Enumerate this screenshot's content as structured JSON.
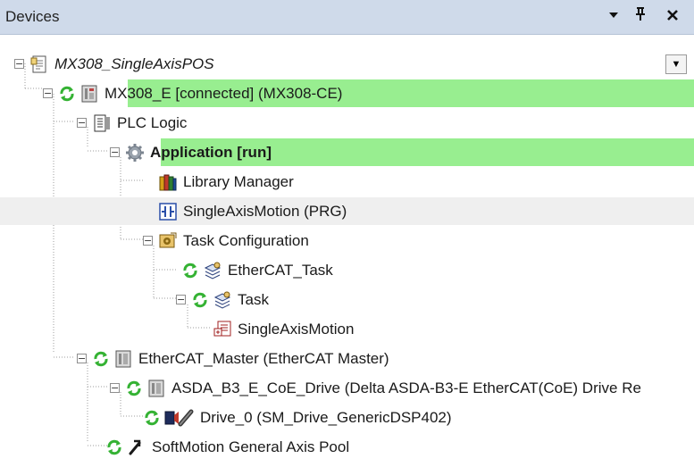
{
  "panel": {
    "title": "Devices",
    "pin_label": "‑↔",
    "close_label": "✕"
  },
  "tree": {
    "project": "MX308_SingleAxisPOS",
    "device": "MX308_E [connected] (MX308-CE)",
    "plc_logic": "PLC Logic",
    "application": "Application [run]",
    "library_manager": "Library Manager",
    "single_axis_motion_prg": "SingleAxisMotion (PRG)",
    "task_configuration": "Task Configuration",
    "ethercat_task": "EtherCAT_Task",
    "task": "Task",
    "single_axis_motion": "SingleAxisMotion",
    "ethercat_master": "EtherCAT_Master (EtherCAT Master)",
    "asda_drive": "ASDA_B3_E_CoE_Drive (Delta ASDA-B3-E EtherCAT(CoE) Drive Re",
    "drive_0": "Drive_0 (SM_Drive_GenericDSP402)",
    "axis_pool": "SoftMotion General Axis Pool"
  },
  "colors": {
    "header_bg": "#cfdaea",
    "highlight_green": "#98ee90",
    "highlight_gray": "#efefef",
    "sync_green": "#34b233"
  }
}
